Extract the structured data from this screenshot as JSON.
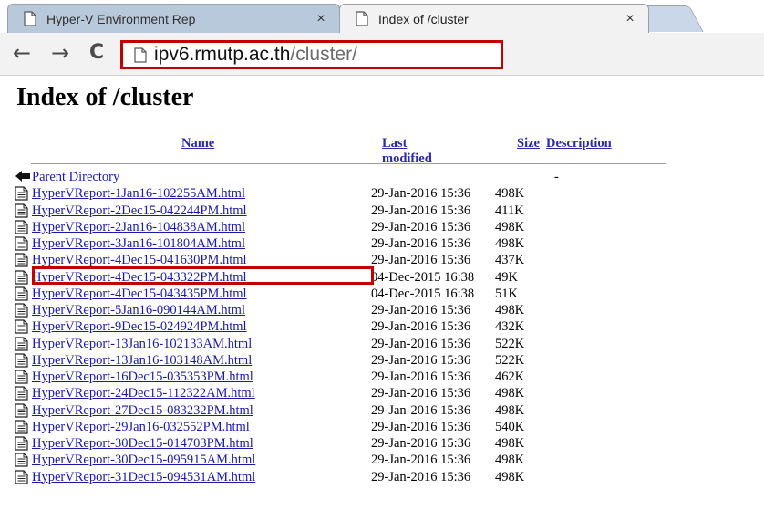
{
  "browser": {
    "tabs": [
      {
        "title": "Hyper-V Environment Rep",
        "active": false
      },
      {
        "title": "Index of /cluster",
        "active": true
      }
    ],
    "tab_close_glyph": "×",
    "url_host": "ipv6.rmutp.ac.th",
    "url_path": "/cluster/",
    "nav": {
      "back": "←",
      "forward": "→",
      "reload": "C"
    },
    "highlight_color": "#c00000"
  },
  "page": {
    "heading": "Index of /cluster",
    "columns": {
      "name": "Name",
      "last_modified": "Last modified",
      "size": "Size",
      "description": "Description"
    },
    "parent": {
      "label": "Parent Directory",
      "size": "-"
    },
    "files": [
      {
        "name": "HyperVReport-1Jan16-102255AM.html",
        "modified": "29-Jan-2016 15:36",
        "size": "498K"
      },
      {
        "name": "HyperVReport-2Dec15-042244PM.html",
        "modified": "29-Jan-2016 15:36",
        "size": "411K"
      },
      {
        "name": "HyperVReport-2Jan16-104838AM.html",
        "modified": "29-Jan-2016 15:36",
        "size": "498K"
      },
      {
        "name": "HyperVReport-3Jan16-101804AM.html",
        "modified": "29-Jan-2016 15:36",
        "size": "498K"
      },
      {
        "name": "HyperVReport-4Dec15-041630PM.html",
        "modified": "29-Jan-2016 15:36",
        "size": "437K"
      },
      {
        "name": "HyperVReport-4Dec15-043322PM.html",
        "modified": "04-Dec-2015 16:38",
        "size": "49K"
      },
      {
        "name": "HyperVReport-4Dec15-043435PM.html",
        "modified": "04-Dec-2015 16:38",
        "size": "51K"
      },
      {
        "name": "HyperVReport-5Jan16-090144AM.html",
        "modified": "29-Jan-2016 15:36",
        "size": "498K"
      },
      {
        "name": "HyperVReport-9Dec15-024924PM.html",
        "modified": "29-Jan-2016 15:36",
        "size": "432K"
      },
      {
        "name": "HyperVReport-13Jan16-102133AM.html",
        "modified": "29-Jan-2016 15:36",
        "size": "522K"
      },
      {
        "name": "HyperVReport-13Jan16-103148AM.html",
        "modified": "29-Jan-2016 15:36",
        "size": "522K"
      },
      {
        "name": "HyperVReport-16Dec15-035353PM.html",
        "modified": "29-Jan-2016 15:36",
        "size": "462K"
      },
      {
        "name": "HyperVReport-24Dec15-112322AM.html",
        "modified": "29-Jan-2016 15:36",
        "size": "498K"
      },
      {
        "name": "HyperVReport-27Dec15-083232PM.html",
        "modified": "29-Jan-2016 15:36",
        "size": "498K"
      },
      {
        "name": "HyperVReport-29Jan16-032552PM.html",
        "modified": "29-Jan-2016 15:36",
        "size": "540K"
      },
      {
        "name": "HyperVReport-30Dec15-014703PM.html",
        "modified": "29-Jan-2016 15:36",
        "size": "498K"
      },
      {
        "name": "HyperVReport-30Dec15-095915AM.html",
        "modified": "29-Jan-2016 15:36",
        "size": "498K"
      },
      {
        "name": "HyperVReport-31Dec15-094531AM.html",
        "modified": "29-Jan-2016 15:36",
        "size": "498K"
      }
    ]
  }
}
